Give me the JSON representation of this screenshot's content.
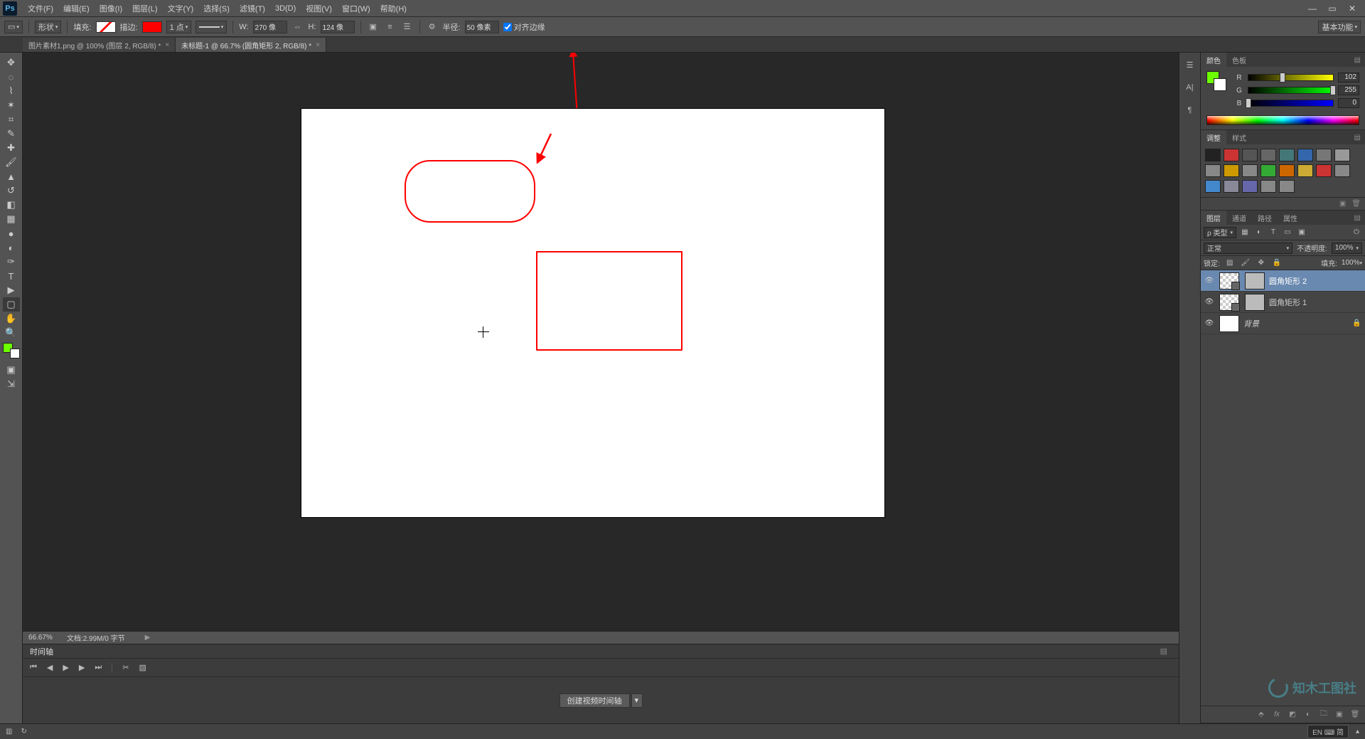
{
  "menubar": {
    "items": [
      "文件(F)",
      "编辑(E)",
      "图像(I)",
      "图层(L)",
      "文字(Y)",
      "选择(S)",
      "滤镜(T)",
      "3D(D)",
      "视图(V)",
      "窗口(W)",
      "帮助(H)"
    ]
  },
  "options": {
    "mode_label": "形状",
    "fill_label": "填充:",
    "stroke_label": "描边:",
    "stroke_width": "1 点",
    "w_label": "W:",
    "w_value": "270 像",
    "h_label": "H:",
    "h_value": "124 像",
    "radius_label": "半径:",
    "radius_value": "50 像素",
    "align_edges_label": "对齐边缘",
    "workspace_label": "基本功能"
  },
  "tabs": [
    {
      "title": "图片素材1.png @ 100% (图层 2, RGB/8) *",
      "active": false
    },
    {
      "title": "未标题-1 @ 66.7% (圆角矩形 2, RGB/8) *",
      "active": true
    }
  ],
  "status": {
    "zoom": "66.67%",
    "doc_info": "文档:2.99M/0 字节"
  },
  "timeline": {
    "tab_label": "时间轴",
    "create_label": "创建视频时间轴"
  },
  "color_panel": {
    "tabs": [
      "颜色",
      "色板"
    ],
    "channels": [
      {
        "label": "R",
        "value": "102",
        "grad": "linear-gradient(to right,#000,#ff0)"
      },
      {
        "label": "G",
        "value": "255",
        "grad": "linear-gradient(to right,#000,#0f0)"
      },
      {
        "label": "B",
        "value": "0",
        "grad": "linear-gradient(to right,#000,#00f)"
      }
    ],
    "fg": "#6cff00",
    "bg": "#ffffff"
  },
  "adjust_panel": {
    "tabs": [
      "调整",
      "样式"
    ]
  },
  "layers_panel": {
    "tabs": [
      "图层",
      "通道",
      "路径",
      "属性"
    ],
    "kind_label": "ρ 类型",
    "blend_mode": "正常",
    "opacity_label": "不透明度:",
    "opacity_value": "100%",
    "lock_label": "锁定:",
    "fill_label": "填充:",
    "fill_value": "100%",
    "layers": [
      {
        "name": "圆角矩形 2",
        "selected": true,
        "thumb": "vec"
      },
      {
        "name": "圆角矩形 1",
        "selected": false,
        "thumb": "vec"
      },
      {
        "name": "背景",
        "selected": false,
        "thumb": "white",
        "locked": true,
        "italic": true
      }
    ]
  },
  "os": {
    "ime": "EN ⌨ 简"
  },
  "watermark_text": "知木工图社"
}
